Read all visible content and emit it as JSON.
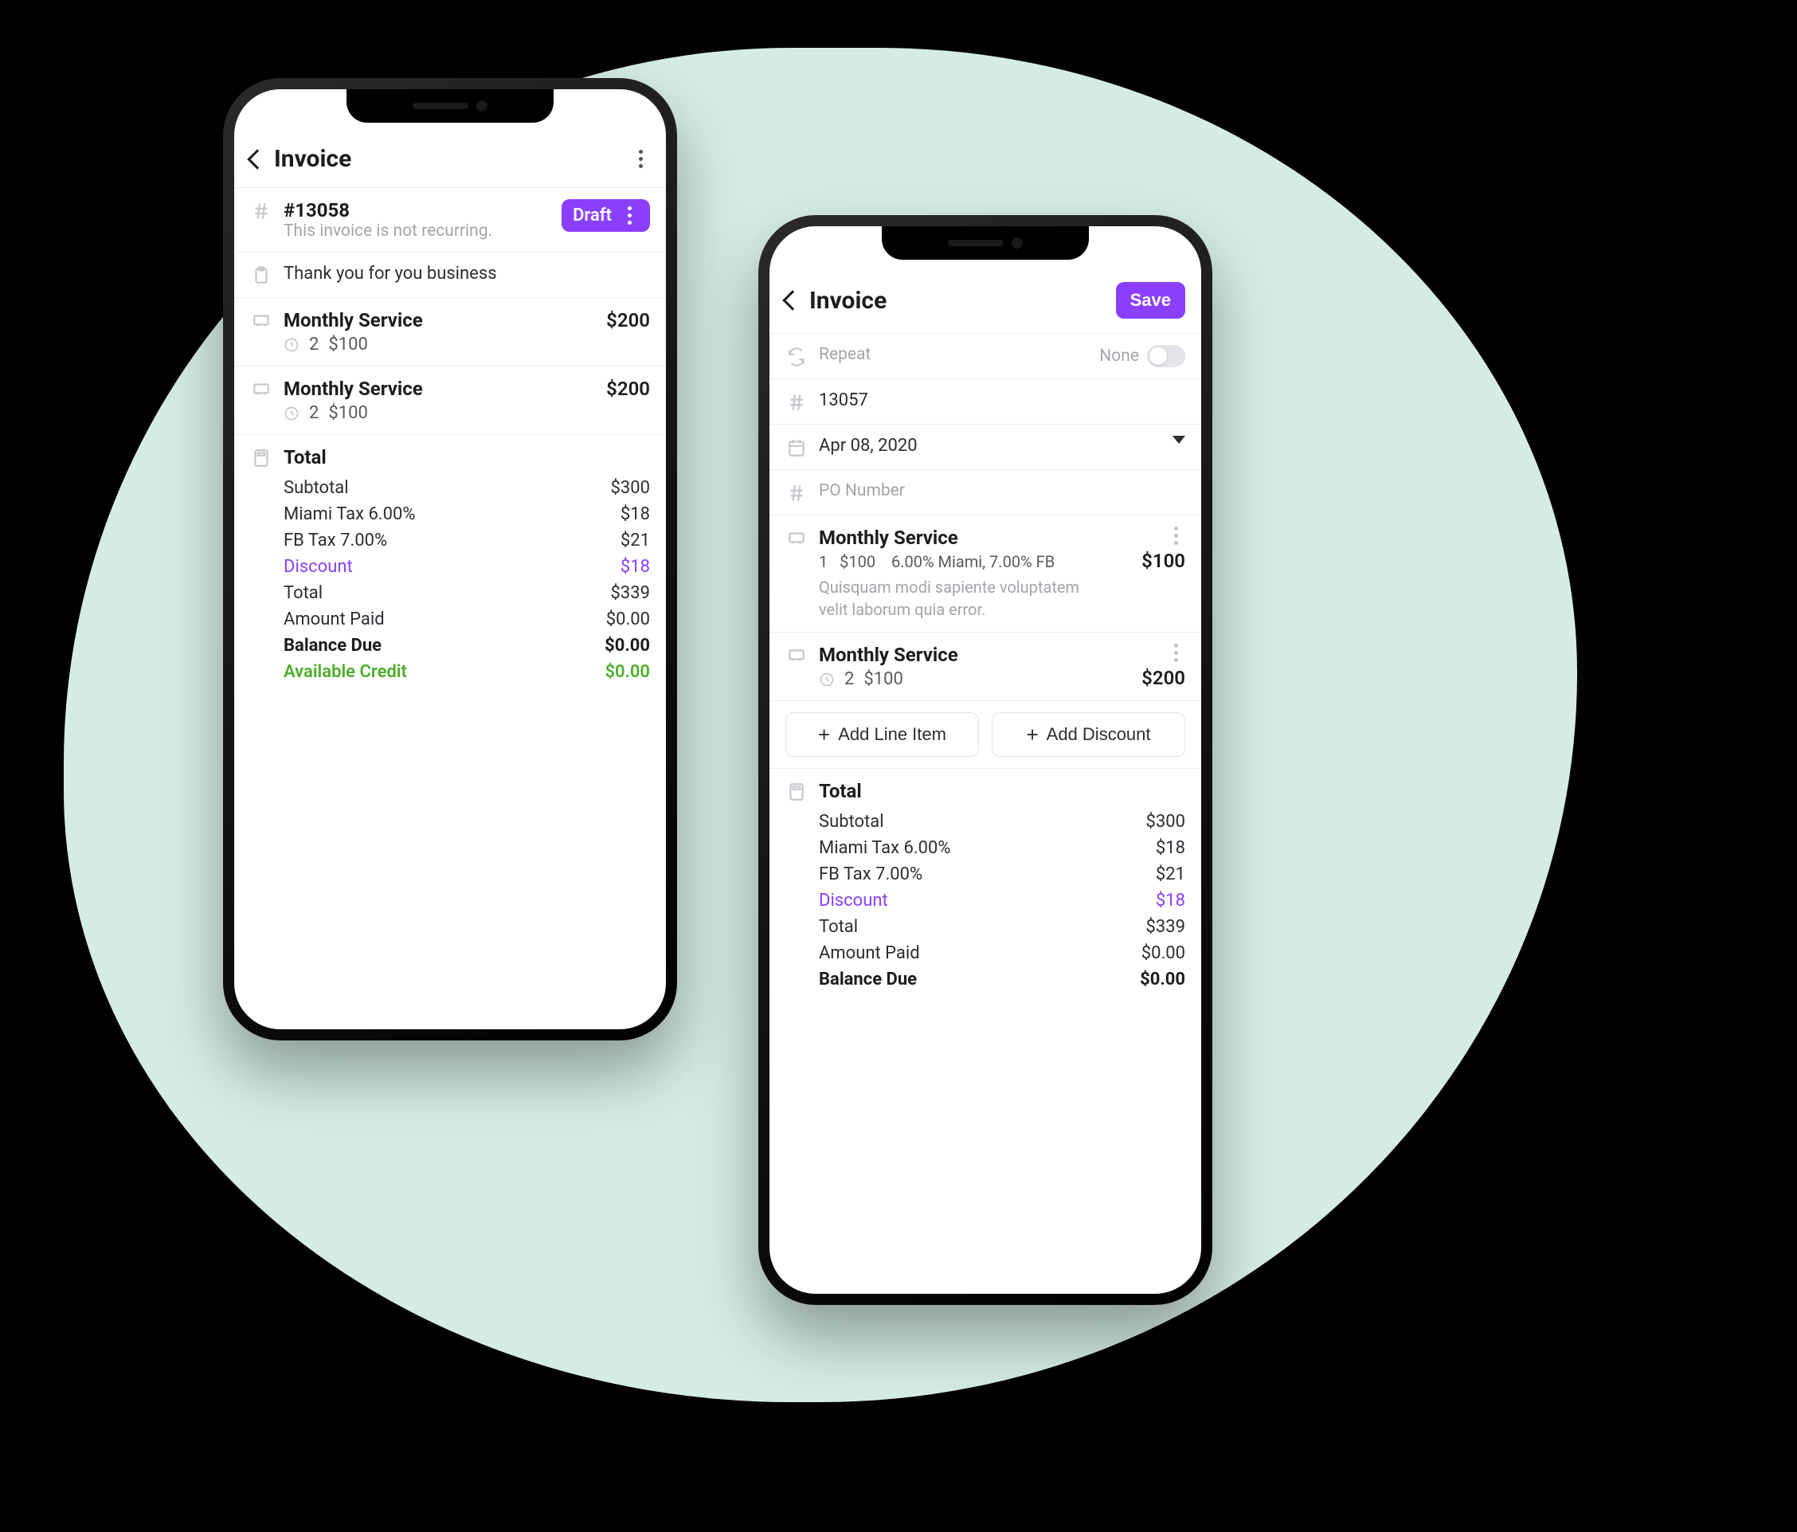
{
  "colors": {
    "accent": "#8a3ffc",
    "success": "#4caf2a",
    "muted": "#a4a4ab",
    "bg_blob": "#d5ece6"
  },
  "left": {
    "header": {
      "title": "Invoice"
    },
    "badge": {
      "number": "#13058",
      "status": "Draft",
      "recurring_note": "This invoice is not recurring."
    },
    "thanks": "Thank you for you business",
    "services": [
      {
        "name": "Monthly Service",
        "qty": "2",
        "price": "$100",
        "amount": "$200"
      },
      {
        "name": "Monthly Service",
        "qty": "2",
        "price": "$100",
        "amount": "$200"
      }
    ],
    "total_label": "Total",
    "calc": {
      "subtotal_label": "Subtotal",
      "subtotal": "$300",
      "tax1_label": "Miami Tax 6.00%",
      "tax1": "$18",
      "tax2_label": "FB Tax 7.00%",
      "tax2": "$21",
      "discount_label": "Discount",
      "discount": "$18",
      "total_label": "Total",
      "total": "$339",
      "paid_label": "Amount Paid",
      "paid": "$0.00",
      "balance_label": "Balance Due",
      "balance": "$0.00",
      "credit_label": "Available Credit",
      "credit": "$0.00"
    }
  },
  "right": {
    "header": {
      "title": "Invoice",
      "save": "Save"
    },
    "repeat": {
      "label": "Repeat",
      "value": "None"
    },
    "number": "13057",
    "date": "Apr 08, 2020",
    "po_placeholder": "PO Number",
    "services": [
      {
        "name": "Monthly Service",
        "detail_qty": "1",
        "detail_price": "$100",
        "detail_tax": "6.00% Miami, 7.00% FB",
        "amount": "$100",
        "note": "Quisquam modi sapiente voluptatem velit laborum quia error."
      },
      {
        "name": "Monthly Service",
        "qty": "2",
        "price": "$100",
        "amount": "$200"
      }
    ],
    "add_line": "Add Line Item",
    "add_discount": "Add Discount",
    "total_label": "Total",
    "calc": {
      "subtotal_label": "Subtotal",
      "subtotal": "$300",
      "tax1_label": "Miami Tax 6.00%",
      "tax1": "$18",
      "tax2_label": "FB Tax 7.00%",
      "tax2": "$21",
      "discount_label": "Discount",
      "discount": "$18",
      "total_label": "Total",
      "total": "$339",
      "paid_label": "Amount Paid",
      "paid": "$0.00",
      "balance_label": "Balance Due",
      "balance": "$0.00"
    }
  }
}
